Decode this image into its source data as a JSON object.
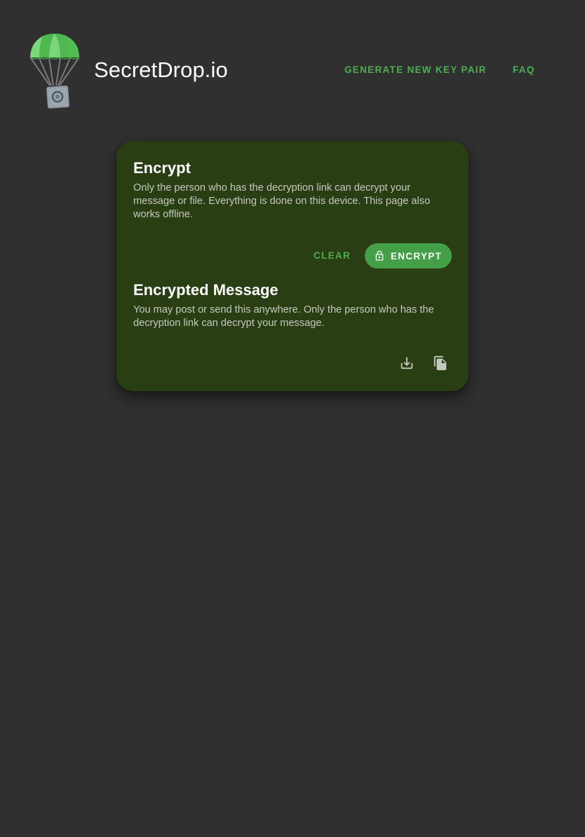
{
  "header": {
    "brand": "SecretDrop.io",
    "nav": {
      "generate_label": "GENERATE NEW KEY PAIR",
      "faq_label": "FAQ"
    },
    "logo_icon": "parachute-safe-icon"
  },
  "encrypt": {
    "title": "Encrypt",
    "description": "Only the person who has the decryption link can decrypt your message or file. Everything is done on this device. This page also works offline.",
    "clear_label": "CLEAR",
    "encrypt_label": "ENCRYPT",
    "encrypt_icon": "lock-icon"
  },
  "encrypted_message": {
    "title": "Encrypted Message",
    "description": "You may post or send this anywhere. Only the person who has the decryption link can decrypt your message.",
    "download_icon": "download-icon",
    "copy_icon": "copy-icon"
  },
  "colors": {
    "background": "#303030",
    "card": "#2a3e13",
    "accent": "#4caf50",
    "button": "#43a047",
    "text": "#ffffff",
    "muted_text": "#c6c9c0"
  }
}
